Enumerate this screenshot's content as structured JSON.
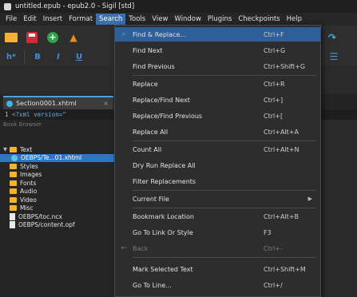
{
  "window": {
    "title": "untitled.epub - epub2.0 - Sigil [std]"
  },
  "menubar": {
    "items": [
      "File",
      "Edit",
      "Insert",
      "Format",
      "Search",
      "Tools",
      "View",
      "Window",
      "Plugins",
      "Checkpoints",
      "Help"
    ],
    "active": "Search"
  },
  "toolbar": {
    "row1_icons": [
      "open-folder",
      "save",
      "add",
      "up-arrow"
    ],
    "row2_text": [
      "h*",
      "B",
      "I",
      "U"
    ],
    "right_icons": [
      "redo",
      "list"
    ]
  },
  "tab": {
    "label": "Section0001.xhtml",
    "close": "×"
  },
  "editor": {
    "line_number": "1",
    "code": "<?xml version=\""
  },
  "sidebar": {
    "header": "Book Browser",
    "tree": [
      {
        "label": "Text",
        "type": "folder",
        "expanded": true,
        "depth": 0
      },
      {
        "label": "OEBPS/Te...01.xhtml",
        "type": "file-html",
        "selected": true,
        "depth": 1
      },
      {
        "label": "Styles",
        "type": "folder",
        "depth": 0
      },
      {
        "label": "Images",
        "type": "folder",
        "depth": 0
      },
      {
        "label": "Fonts",
        "type": "folder",
        "depth": 0
      },
      {
        "label": "Audio",
        "type": "folder",
        "depth": 0
      },
      {
        "label": "Video",
        "type": "folder",
        "depth": 0
      },
      {
        "label": "Misc",
        "type": "folder",
        "depth": 0
      },
      {
        "label": "OEBPS/toc.ncx",
        "type": "file",
        "depth": 0
      },
      {
        "label": "OEBPS/content.opf",
        "type": "file",
        "depth": 0
      }
    ]
  },
  "search_menu": {
    "items": [
      {
        "label": "Find & Replace...",
        "shortcut": "Ctrl+F",
        "icon": "search-icon",
        "highlighted": true
      },
      {
        "label": "Find Next",
        "shortcut": "Ctrl+G"
      },
      {
        "label": "Find Previous",
        "shortcut": "Ctrl+Shift+G"
      },
      {
        "label": "Replace",
        "shortcut": "Ctrl+R"
      },
      {
        "label": "Replace/Find Next",
        "shortcut": "Ctrl+]"
      },
      {
        "label": "Replace/Find Previous",
        "shortcut": "Ctrl+["
      },
      {
        "label": "Replace All",
        "shortcut": "Ctrl+Alt+A"
      },
      {
        "label": "Count All",
        "shortcut": "Ctrl+Alt+N"
      },
      {
        "label": "Dry Run Replace All",
        "shortcut": ""
      },
      {
        "label": "Filter Replacements",
        "shortcut": ""
      },
      {
        "label": "Current File",
        "shortcut": "",
        "submenu": true
      },
      {
        "label": "Bookmark Location",
        "shortcut": "Ctrl+Alt+B"
      },
      {
        "label": "Go To Link Or Style",
        "shortcut": "F3"
      },
      {
        "label": "Back",
        "shortcut": "Ctrl+-",
        "disabled": true,
        "icon": "back-arrow-icon"
      },
      {
        "label": "Mark Selected Text",
        "shortcut": "Ctrl+Shift+M"
      },
      {
        "label": "Go To Line...",
        "shortcut": "Ctrl+/"
      }
    ]
  },
  "colors": {
    "accent": "#2e5f98",
    "menu_active": "#3a6fb0",
    "selection": "#2f75c4",
    "folder": "#f2b233"
  }
}
